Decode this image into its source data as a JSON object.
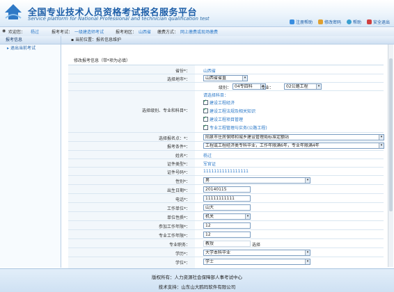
{
  "header": {
    "title_cn": "全国专业技术人员资格考试报名服务平台",
    "title_en": "Service platform for National Professional and technician qualification test",
    "links": [
      "注册帮助",
      "修改密码",
      "帮助",
      "安全退出"
    ]
  },
  "infobar": {
    "welcome_label": "欢迎您：",
    "welcome_value": "杨过",
    "exam_label": "报考考试：",
    "exam_value": "一级建造师考试",
    "region_label": "报考地区：",
    "region_value": "山西省",
    "fee_label": "缴费方式：",
    "fee_value": "网上缴费或现场缴费"
  },
  "sidebar": {
    "header": "报考信息",
    "items": [
      "退出当前考试"
    ]
  },
  "breadcrumb": "当前位置：报名信息维护",
  "form": {
    "title": "修改报考信息（带*项为必填）",
    "province": {
      "label": "省份*：",
      "value": "山西省"
    },
    "city": {
      "label": "选择地市*：",
      "value": "山西省省直"
    },
    "level": {
      "label": "级别：",
      "value": "04专四科",
      "major_label": "专业：",
      "major_value": "02公路工程"
    },
    "subjects": {
      "label": "选择级别、专业和科目*：",
      "hint": "请选择科目：",
      "items": [
        "建设工程经济",
        "建设工程法规及相关知识",
        "建设工程项目管理",
        "专业工程管理与实务(公路工程)"
      ]
    },
    "site": {
      "label": "选择报名点：*：",
      "value": "阳泉市住房保障和城乡建设管理局标准定额站"
    },
    "condition": {
      "label": "报考条件*：",
      "value": "工程或工程经济类专科毕业，工作年限满6年，专业年限满4年"
    },
    "name": {
      "label": "姓名*：",
      "value": "杨过"
    },
    "id_type": {
      "label": "证件类型*：",
      "value": "军官证"
    },
    "id_no": {
      "label": "证件号码*：",
      "value": "11111111111111111"
    },
    "gender": {
      "label": "性别*：",
      "value": "男"
    },
    "birth": {
      "label": "出生日期*：",
      "value": "20140115"
    },
    "phone": {
      "label": "电话*：",
      "value": "11111111111"
    },
    "work_unit": {
      "label": "工作单位*：",
      "value": "山大"
    },
    "unit_nature": {
      "label": "单位性质*：",
      "value": "机关"
    },
    "work_years": {
      "label": "参加工作年限*：",
      "value": "12"
    },
    "pro_years": {
      "label": "专业工作年限*：",
      "value": "12"
    },
    "title_rank": {
      "label": "专业职务：",
      "value": "教授",
      "action": "选择"
    },
    "education": {
      "label": "学历*：",
      "value": "大学本科毕业"
    },
    "degree": {
      "label": "学位*：",
      "value": "学士"
    }
  },
  "footer": {
    "line1": "版权所有：人力资源社会保障部人事考试中心",
    "line2": "技术支持：山东山大鸥玛软件有限公司"
  }
}
